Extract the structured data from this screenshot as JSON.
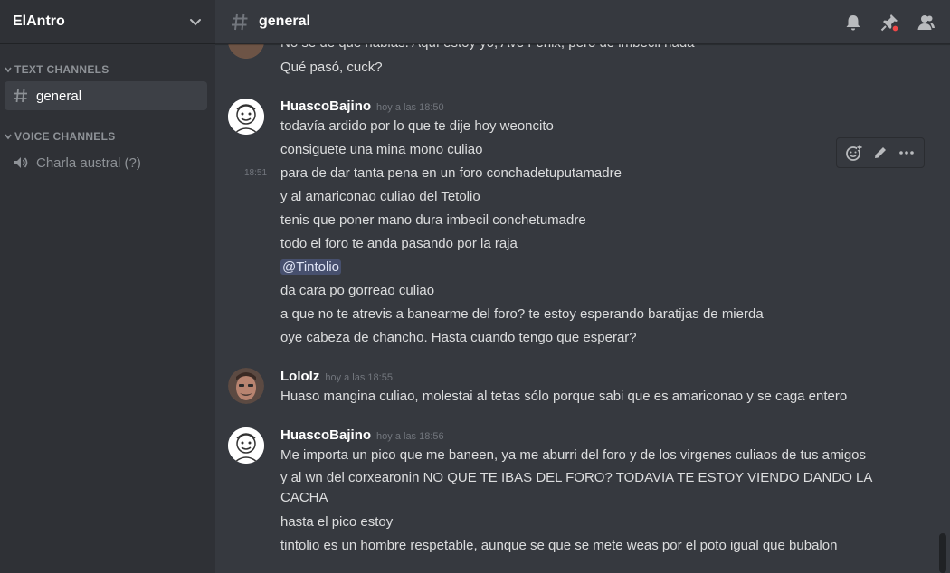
{
  "server": {
    "name": "ElAntro"
  },
  "categories": {
    "text": "TEXT CHANNELS",
    "voice": "VOICE CHANNELS"
  },
  "channels": {
    "text": [
      {
        "name": "general",
        "active": true
      }
    ],
    "voice": [
      {
        "name": "Charla austral (?)"
      }
    ]
  },
  "header": {
    "channel_name": "general"
  },
  "messages": {
    "prev_lines": [
      "No sé de que hablás. Aquí estoy yo, Ave Fénix, pero de imbécil nada",
      "Qué pasó, cuck?"
    ],
    "group1": {
      "author": "HuascoBajino",
      "timestamp": "hoy a las 18:50",
      "side_timestamp": "18:51",
      "lines": [
        "todavía ardido por lo que te dije hoy weoncito",
        "consiguete una mina mono culiao",
        "para de dar tanta pena en un foro conchadetuputamadre",
        "y al amariconao culiao del Tetolio",
        "tenis que poner mano dura imbecil conchetumadre",
        "todo el foro te anda pasando por la raja",
        "@Tintolio",
        "da cara po gorreao culiao",
        "a que no te atrevis a banearme del foro? te estoy esperando baratijas de mierda",
        "oye cabeza de chancho. Hasta cuando tengo que esperar?"
      ]
    },
    "group2": {
      "author": "Lololz",
      "timestamp": "hoy a las 18:55",
      "lines": [
        "Huaso mangina culiao, molestai al tetas sólo porque sabi que es amariconao y se caga entero"
      ]
    },
    "group3": {
      "author": "HuascoBajino",
      "timestamp": "hoy a las 18:56",
      "lines": [
        "Me importa un pico que me baneen, ya me aburri del foro y de los virgenes culiaos de tus amigos",
        "y al wn del corxearonin NO QUE TE IBAS DEL FORO? TODAVIA TE ESTOY VIENDO DANDO LA CACHA",
        "hasta el pico estoy",
        "tintolio es un hombre respetable, aunque se que se mete weas por el poto igual que bubalon"
      ]
    }
  },
  "icons": {
    "header": [
      "bell-icon",
      "pin-icon",
      "members-icon"
    ],
    "hover_toolbar": [
      "add-reaction-icon",
      "edit-icon",
      "more-icon"
    ]
  },
  "colors": {
    "background": "#36393f",
    "sidebar": "#2f3136",
    "mention_bg": "#4a5080",
    "pin_badge": "#f04747"
  }
}
